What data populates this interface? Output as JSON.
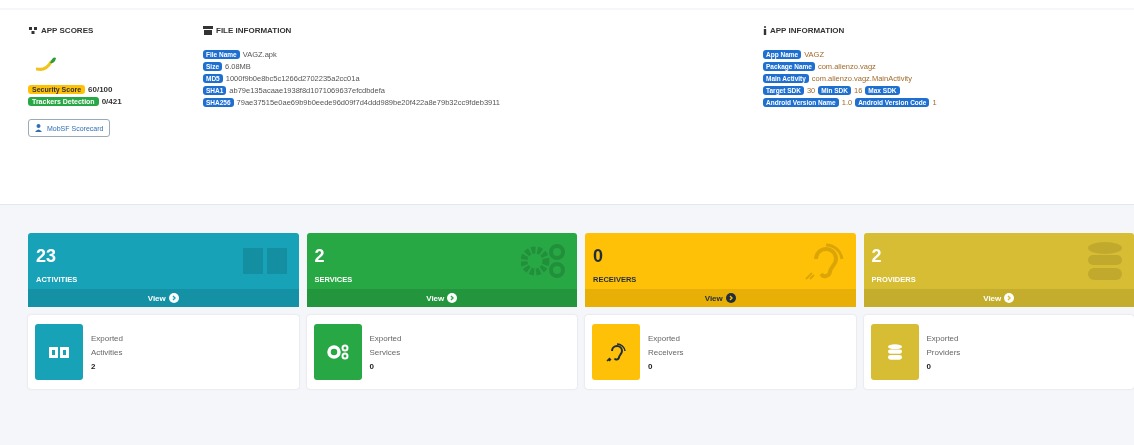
{
  "app_scores": {
    "title": "APP SCORES",
    "badges": [
      {
        "label": "Security Score",
        "value": "60/100",
        "kind": "warning"
      },
      {
        "label": "Trackers Detection",
        "value": "0/421",
        "kind": "success"
      }
    ],
    "button": "MobSF Scorecard"
  },
  "file_information": {
    "title": "FILE INFORMATION",
    "rows": [
      {
        "label": "File Name",
        "value": "VAGZ.apk"
      },
      {
        "label": "Size",
        "value": "6.08MB"
      },
      {
        "label": "MD5",
        "value": "1000f9b0e8bc5c1266d2702235a2cc01a"
      },
      {
        "label": "SHA1",
        "value": "ab79e135acaae1938f8d1071069637efcdbdefa"
      },
      {
        "label": "SHA256",
        "value": "79ae37515e0ae69b9b0eede96d09f7d4ddd989be20f422a8e79b32cc9fdeb3911"
      }
    ]
  },
  "app_information": {
    "title": "APP INFORMATION",
    "rows": [
      {
        "fields": [
          {
            "label": "App Name",
            "value": "VAGZ"
          }
        ]
      },
      {
        "fields": [
          {
            "label": "Package Name",
            "value": "com.alienzo.vagz"
          }
        ]
      },
      {
        "fields": [
          {
            "label": "Main Activity",
            "value": "com.alienzo.vagz.MainActivity"
          }
        ]
      },
      {
        "fields": [
          {
            "label": "Target SDK",
            "value": "30"
          },
          {
            "label": "Min SDK",
            "value": "16"
          },
          {
            "label": "Max SDK"
          }
        ]
      },
      {
        "fields": [
          {
            "label": "Android Version Name",
            "value": "1.0"
          },
          {
            "label": "Android Version Code",
            "value": "1"
          }
        ]
      }
    ]
  },
  "components": [
    {
      "kind": "activities",
      "count": "23",
      "label": "ACTIVITIES",
      "link": "View",
      "exported_title": "Exported",
      "exported_label": "Activities",
      "exported_count": "2"
    },
    {
      "kind": "services",
      "count": "2",
      "label": "SERVICES",
      "link": "View",
      "exported_title": "Exported",
      "exported_label": "Services",
      "exported_count": "0"
    },
    {
      "kind": "receivers",
      "count": "0",
      "label": "RECEIVERS",
      "link": "View",
      "exported_title": "Exported",
      "exported_label": "Receivers",
      "exported_count": "0"
    },
    {
      "kind": "providers",
      "count": "2",
      "label": "PROVIDERS",
      "link": "View",
      "exported_title": "Exported",
      "exported_label": "Providers",
      "exported_count": "0"
    }
  ]
}
